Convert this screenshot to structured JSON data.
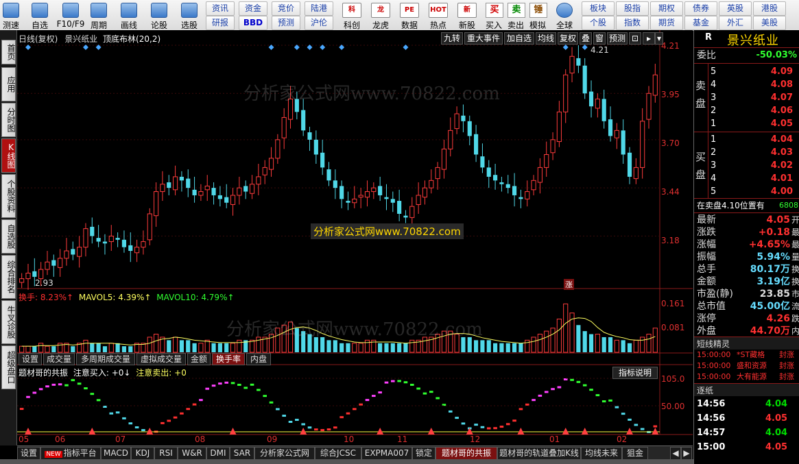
{
  "toolbar": {
    "items": [
      {
        "label": "测速"
      },
      {
        "label": "自选"
      },
      {
        "label": "F10/F9"
      },
      {
        "label": "周期"
      },
      {
        "label": "画线"
      },
      {
        "label": "论股"
      },
      {
        "label": "选股"
      }
    ],
    "mini_row1": [
      "资讯",
      "资金",
      "竞价",
      "陆港"
    ],
    "mini_row2": [
      "研报",
      "BBD",
      "预测",
      "沪伦"
    ],
    "icons2": [
      {
        "label": "科创",
        "icon": "科"
      },
      {
        "label": "龙虎",
        "icon": "龙"
      },
      {
        "label": "数据",
        "icon": "PE"
      },
      {
        "label": "热点",
        "icon": "HOT"
      },
      {
        "label": "新股",
        "icon": "新"
      }
    ],
    "trade": [
      {
        "label": "买入",
        "glyph": "买",
        "color": "#d00000"
      },
      {
        "label": "卖出",
        "glyph": "卖",
        "color": "#008800"
      },
      {
        "label": "模拟",
        "glyph": "锤",
        "color": "#8a4a00"
      }
    ],
    "global": "全球",
    "right_row1": [
      "板块",
      "股指",
      "期权",
      "债券",
      "英股",
      "港股"
    ],
    "right_row2": [
      "个股",
      "指数",
      "期货",
      "基金",
      "外汇",
      "美股"
    ]
  },
  "left_tabs": [
    {
      "label": "首页",
      "active": false
    },
    {
      "label": "应用",
      "active": false
    },
    {
      "label": "分时图",
      "active": false
    },
    {
      "label": "K线图",
      "active": true
    },
    {
      "label": "个股资料",
      "active": false
    },
    {
      "label": "自选股",
      "active": false
    },
    {
      "label": "综合排名",
      "active": false
    },
    {
      "label": "牛叉诊股",
      "active": false
    },
    {
      "label": "超级盘口",
      "active": false
    }
  ],
  "chart_header": {
    "period": "日线(复权)",
    "name": "景兴纸业",
    "indicator": "顶底布林(20,2)"
  },
  "chart_buttons": [
    "九转",
    "重大事件",
    "加自选",
    "均线",
    "复权",
    "叠",
    "窗",
    "预测"
  ],
  "price_axis": [
    "4.21",
    "3.95",
    "3.70",
    "3.44",
    "3.18"
  ],
  "price_high_label": "4.21",
  "price_low_label": "2.93",
  "watermark": "分析家公式网www.70822.com",
  "center_banner": "分析家公式网www.70822.com",
  "zhang_mark": "涨",
  "vol_legend": {
    "turnover": "换手: 8.23%↑",
    "mavol5": "MAVOL5: 4.39%↑",
    "mavol10": "MAVOL10: 4.79%↑"
  },
  "vol_axis": [
    "0.161",
    "0.081"
  ],
  "sub_tabs": [
    {
      "label": "设置",
      "active": false
    },
    {
      "label": "成交量",
      "active": false
    },
    {
      "label": "多周期成交量",
      "active": false
    },
    {
      "label": "虚拟成交量",
      "active": false
    },
    {
      "label": "金额",
      "active": false
    },
    {
      "label": "换手率",
      "active": true
    },
    {
      "label": "内盘",
      "active": false
    }
  ],
  "indicator_legend": {
    "name": "题材哥的共振",
    "buy": "注意买入: +0↓",
    "sell": "注意卖出: +0"
  },
  "indicator_button": "指标说明",
  "ind_axis": [
    "105.0",
    "50.00"
  ],
  "date_labels": [
    "05",
    "06",
    "07",
    "08",
    "09",
    "10",
    "11",
    "12",
    "01",
    "02"
  ],
  "chart_data": {
    "type": "candlestick",
    "ylim": [
      2.93,
      4.21
    ],
    "close": [
      2.95,
      2.98,
      2.96,
      3.0,
      3.04,
      3.02,
      3.06,
      3.1,
      3.08,
      3.12,
      3.22,
      3.18,
      3.15,
      3.14,
      3.18,
      3.16,
      3.12,
      3.1,
      3.12,
      3.15,
      3.3,
      3.42,
      3.46,
      3.44,
      3.5,
      3.48,
      3.44,
      3.4,
      3.42,
      3.45,
      3.4,
      3.38,
      3.36,
      3.4,
      3.44,
      3.42,
      3.46,
      3.5,
      3.55,
      3.6,
      3.7,
      3.82,
      3.92,
      3.85,
      3.75,
      3.7,
      3.62,
      3.55,
      3.48,
      3.44,
      3.38,
      3.36,
      3.38,
      3.4,
      3.42,
      3.44,
      3.4,
      3.38,
      3.36,
      3.3,
      3.28,
      3.34,
      3.4,
      3.44,
      3.48,
      3.55,
      3.65,
      3.75,
      3.84,
      3.8,
      3.72,
      3.62,
      3.55,
      3.5,
      3.48,
      3.46,
      3.44,
      3.4,
      3.38,
      3.42,
      3.48,
      3.55,
      3.62,
      3.7,
      3.85,
      4.05,
      4.15,
      4.1,
      3.95,
      3.88,
      3.92,
      3.8,
      3.72,
      3.75,
      3.62,
      3.5,
      3.55,
      3.8,
      3.95,
      4.05
    ],
    "turnover": [
      0.02,
      0.02,
      0.02,
      0.03,
      0.02,
      0.02,
      0.03,
      0.03,
      0.02,
      0.03,
      0.04,
      0.03,
      0.03,
      0.02,
      0.03,
      0.03,
      0.02,
      0.02,
      0.03,
      0.03,
      0.05,
      0.06,
      0.05,
      0.04,
      0.05,
      0.04,
      0.04,
      0.03,
      0.03,
      0.04,
      0.03,
      0.03,
      0.03,
      0.03,
      0.04,
      0.04,
      0.04,
      0.05,
      0.05,
      0.06,
      0.08,
      0.09,
      0.1,
      0.08,
      0.07,
      0.06,
      0.05,
      0.05,
      0.04,
      0.04,
      0.03,
      0.03,
      0.03,
      0.03,
      0.04,
      0.04,
      0.03,
      0.03,
      0.03,
      0.03,
      0.03,
      0.04,
      0.04,
      0.05,
      0.05,
      0.06,
      0.07,
      0.07,
      0.06,
      0.05,
      0.05,
      0.04,
      0.04,
      0.04,
      0.03,
      0.03,
      0.03,
      0.03,
      0.03,
      0.04,
      0.05,
      0.06,
      0.07,
      0.08,
      0.11,
      0.16,
      0.13,
      0.09,
      0.07,
      0.06,
      0.06,
      0.05,
      0.05,
      0.04,
      0.04,
      0.03,
      0.04,
      0.05,
      0.06,
      0.08
    ]
  },
  "right_panel": {
    "code": "R",
    "name": "景兴纸业",
    "weibi_label": "委比",
    "weibi": "-50.03%",
    "sell_label": "卖盘",
    "buy_label": "买盘",
    "asks": [
      {
        "lvl": "5",
        "price": "4.09"
      },
      {
        "lvl": "4",
        "price": "4.08"
      },
      {
        "lvl": "3",
        "price": "4.07"
      },
      {
        "lvl": "2",
        "price": "4.06"
      },
      {
        "lvl": "1",
        "price": "4.05"
      }
    ],
    "bids": [
      {
        "lvl": "1",
        "price": "4.04"
      },
      {
        "lvl": "2",
        "price": "4.03"
      },
      {
        "lvl": "3",
        "price": "4.02"
      },
      {
        "lvl": "4",
        "price": "4.01"
      },
      {
        "lvl": "5",
        "price": "4.00"
      }
    ],
    "notice": "在卖盘4.10位置有",
    "notice_num": "6808",
    "stats": [
      {
        "label": "最新",
        "value": "4.05",
        "color": "#ff3030",
        "tail": "开"
      },
      {
        "label": "涨跌",
        "value": "+0.18",
        "color": "#ff3030",
        "tail": "最"
      },
      {
        "label": "涨幅",
        "value": "+4.65%",
        "color": "#ff3030",
        "tail": "最"
      },
      {
        "label": "振幅",
        "value": "5.94%",
        "color": "#66ddff",
        "tail": "量"
      },
      {
        "label": "总手",
        "value": "80.17万",
        "color": "#66ddff",
        "tail": "换"
      },
      {
        "label": "金额",
        "value": "3.19亿",
        "color": "#66ddff",
        "tail": "换"
      },
      {
        "label": "市盈(静)",
        "value": "23.85",
        "color": "#dddddd",
        "tail": "市"
      },
      {
        "label": "总市值",
        "value": "45.00亿",
        "color": "#66ddff",
        "tail": "流"
      },
      {
        "label": "涨停",
        "value": "4.26",
        "color": "#ff3030",
        "tail": "跌"
      },
      {
        "label": "外盘",
        "value": "44.70万",
        "color": "#ff3030",
        "tail": "内"
      }
    ],
    "sprite_title": "短线精灵",
    "sprite_rows": [
      {
        "time": "15:00:00",
        "stock": "*ST藏格",
        "event": "封涨"
      },
      {
        "time": "15:00:00",
        "stock": "盛和资源",
        "event": "封涨"
      },
      {
        "time": "15:00:00",
        "stock": "大有能源",
        "event": "封涨"
      }
    ],
    "tick_title": "逐纸",
    "ticks": [
      {
        "time": "14:56",
        "price": "4.04",
        "color": "#00dd00"
      },
      {
        "time": "14:56",
        "price": "4.05",
        "color": "#ff3030"
      },
      {
        "time": "14:57",
        "price": "4.04",
        "color": "#00dd00"
      },
      {
        "time": "15:00",
        "price": "4.05",
        "color": "#ff3030"
      }
    ]
  },
  "bottom_tabs": [
    {
      "label": "设置",
      "active": false
    },
    {
      "label": "指标平台",
      "active": false,
      "badge": "NEW"
    },
    {
      "label": "MACD",
      "active": false
    },
    {
      "label": "KDJ",
      "active": false
    },
    {
      "label": "RSI",
      "active": false
    },
    {
      "label": "W&R",
      "active": false
    },
    {
      "label": "DMI",
      "active": false
    },
    {
      "label": "SAR",
      "active": false
    },
    {
      "label": "分析家公式网",
      "active": false
    },
    {
      "label": "综合JCSC",
      "active": false
    },
    {
      "label": "EXPMA007",
      "active": false
    },
    {
      "label": "锁定",
      "active": false
    },
    {
      "label": "题材哥的共振",
      "active": true
    },
    {
      "label": "题材哥的轨道叠加K线",
      "active": false
    },
    {
      "label": "均线未来",
      "active": false
    },
    {
      "label": "狙金",
      "active": false
    }
  ]
}
